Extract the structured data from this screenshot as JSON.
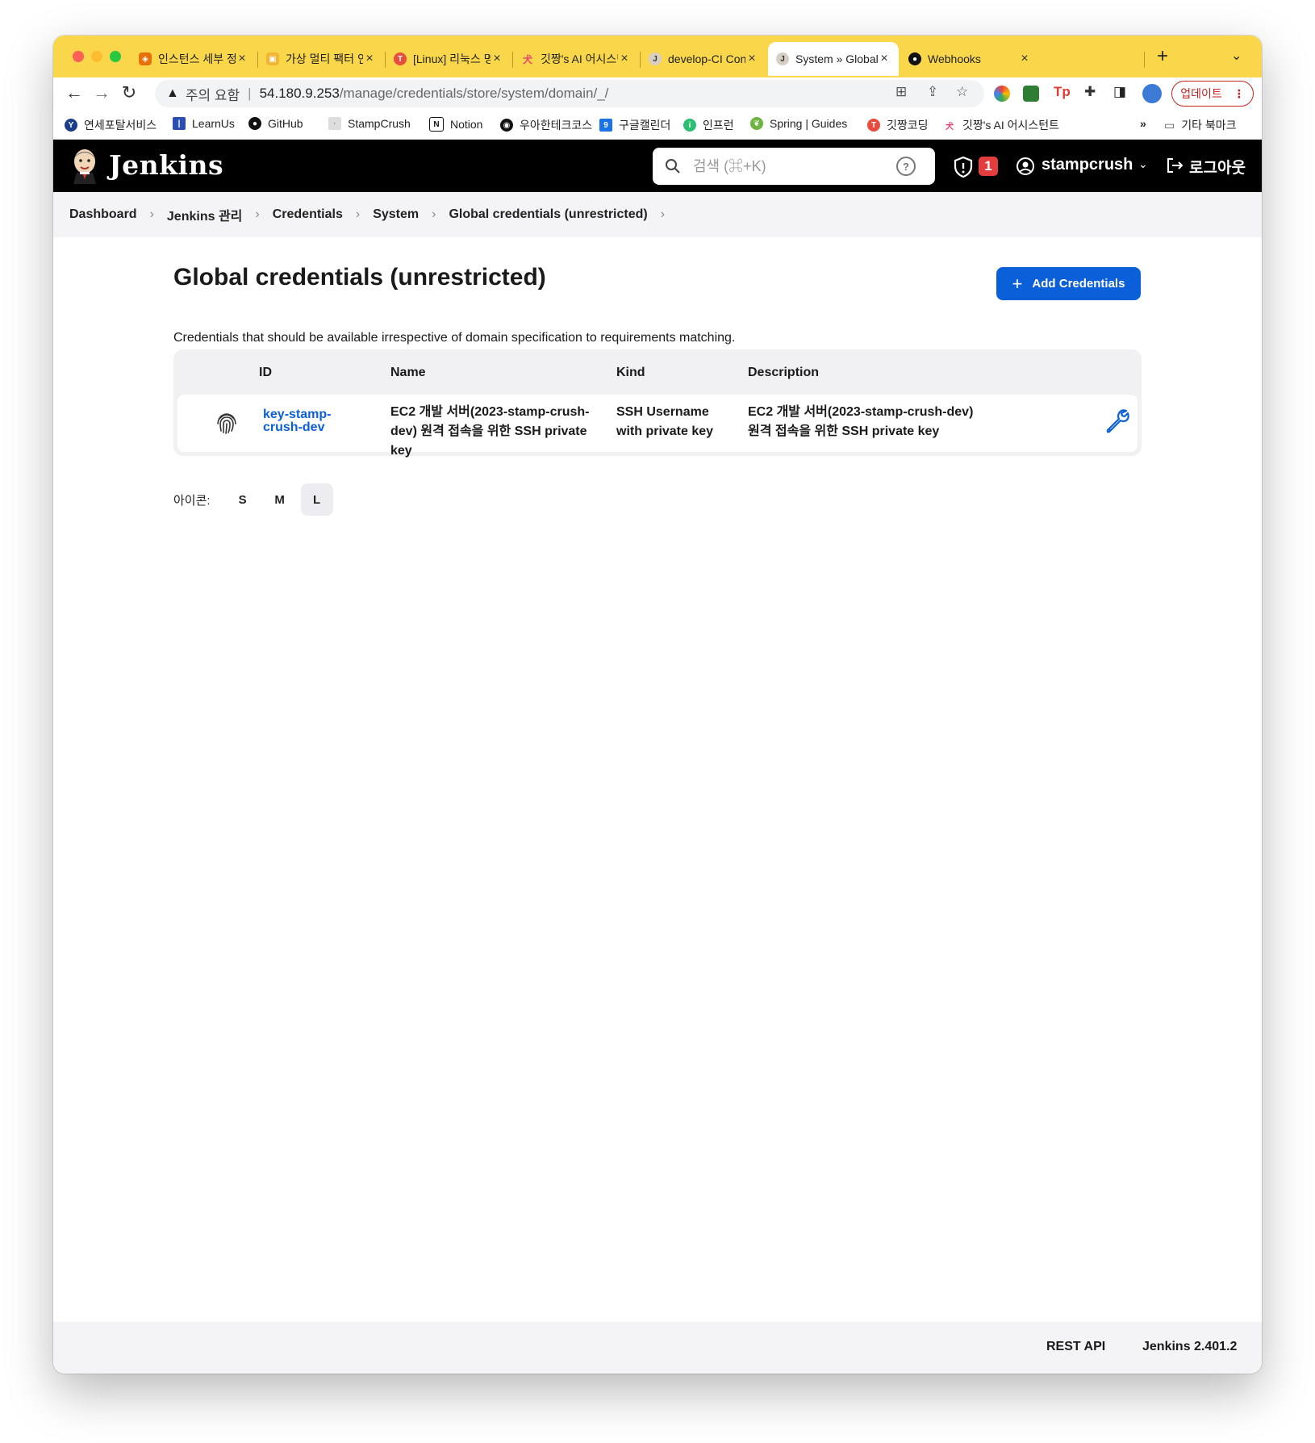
{
  "browser": {
    "tabs": [
      {
        "title": "인스턴스 세부 정보",
        "favicon_color": "#e8700a"
      },
      {
        "title": "가상 멀티 팩터 인증",
        "favicon_color": "#f2b632"
      },
      {
        "title": "[Linux] 리눅스 명령",
        "favicon_color": "#e94c3d"
      },
      {
        "title": "깃짱's AI 어시스턴트",
        "favicon_color": "#e8436f"
      },
      {
        "title": "develop-CI Config",
        "favicon_color": "#8a7a6a"
      },
      {
        "title": "System » Global",
        "favicon_color": "#8a7a6a"
      },
      {
        "title": "Webhooks",
        "favicon_color": "#111111"
      }
    ],
    "new_tab_symbol": "+",
    "tab_menu_symbol": "⌄",
    "close_symbol": "×",
    "address": {
      "warning_label": "주의 요함",
      "host": "54.180.9.253",
      "path": "/manage/credentials/store/system/domain/_/"
    },
    "update_label": "업데이트"
  },
  "bookmarks": [
    {
      "label": "연세포탈서비스",
      "color": "#1d3f8a"
    },
    {
      "label": "LearnUs",
      "color": "#2a4fb0"
    },
    {
      "label": "GitHub",
      "color": "#111111"
    },
    {
      "label": "StampCrush",
      "color": "#999999"
    },
    {
      "label": "Notion",
      "color": "#111111"
    },
    {
      "label": "우아한테크코스",
      "color": "#111111"
    },
    {
      "label": "구글캘린더",
      "color": "#1a73e8"
    },
    {
      "label": "인프런",
      "color": "#2dbd74"
    },
    {
      "label": "Spring | Guides",
      "color": "#6db33f"
    },
    {
      "label": "깃짱코딩",
      "color": "#e94c3d"
    },
    {
      "label": "깃짱's AI 어시스턴트",
      "color": "#e8436f"
    }
  ],
  "bookmarks_overflow": "»",
  "bookmarks_other": "기타 북마크",
  "jenkins": {
    "brand": "Jenkins",
    "search_placeholder": "검색 (⌘+K)",
    "help_symbol": "?",
    "alert_count": "1",
    "username": "stampcrush",
    "logout_label": "로그아웃"
  },
  "breadcrumb": [
    "Dashboard",
    "Jenkins 관리",
    "Credentials",
    "System",
    "Global credentials (unrestricted)"
  ],
  "main": {
    "title": "Global credentials (unrestricted)",
    "add_button_label": "Add Credentials",
    "description": "Credentials that should be available irrespective of domain specification to requirements matching.",
    "table": {
      "headers": {
        "id": "ID",
        "name": "Name",
        "kind": "Kind",
        "description": "Description"
      },
      "rows": [
        {
          "id": "key-stamp-crush-dev",
          "name": "EC2 개발 서버(2023-stamp-crush-dev) 원격 접속을 위한 SSH private key",
          "kind": "SSH Username with private key",
          "description": "EC2 개발 서버(2023-stamp-crush-dev) 원격 접속을 위한 SSH private key"
        }
      ]
    },
    "icon_size": {
      "label": "아이콘:",
      "options": [
        "S",
        "M",
        "L"
      ],
      "selected": "L"
    }
  },
  "footer": {
    "rest_api": "REST API",
    "version": "Jenkins 2.401.2"
  },
  "colors": {
    "tabstrip": "#f9d64a",
    "jenkins_header": "#000000",
    "primary_button": "#0b5fd9",
    "link": "#0b5fd9",
    "alert": "#e33d3d"
  }
}
